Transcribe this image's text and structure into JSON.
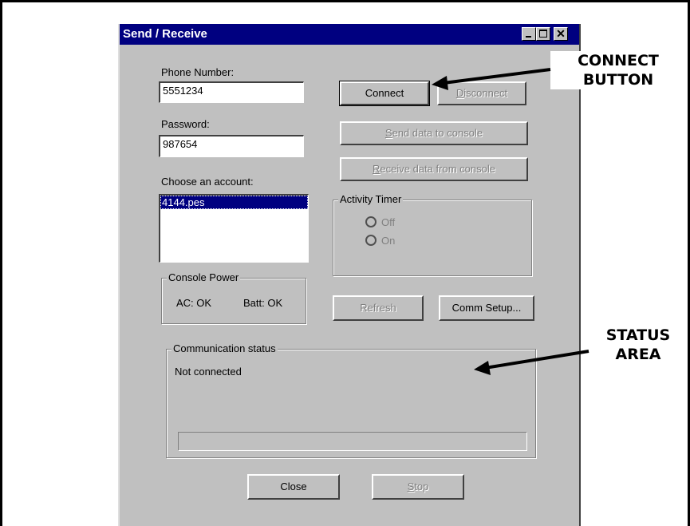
{
  "window": {
    "title": "Send / Receive",
    "controls": {
      "minimize": "_",
      "maximize": "□",
      "close": "✕"
    }
  },
  "phone": {
    "label": "Phone Number:",
    "value": "5551234"
  },
  "password": {
    "label": "Password:",
    "value": "987654"
  },
  "account": {
    "label": "Choose an account:",
    "items": [
      "4144.pes"
    ],
    "selected": "4144.pes"
  },
  "console_power": {
    "title": "Console Power",
    "ac": "AC: OK",
    "batt": "Batt: OK"
  },
  "buttons": {
    "connect": "Connect",
    "disconnect": "Disconnect",
    "send": "Send data to console",
    "receive": "Receive data from console",
    "refresh": "Refresh",
    "comm_setup": "Comm Setup...",
    "close": "Close",
    "stop": "Stop"
  },
  "activity_timer": {
    "title": "Activity Timer",
    "off": "Off",
    "on": "On"
  },
  "comm_status": {
    "title": "Communication status",
    "text": "Not connected",
    "progress": 0
  },
  "annotations": {
    "connect_button_line1": "CONNECT",
    "connect_button_line2": "BUTTON",
    "status_area_line1": "STATUS",
    "status_area_line2": "AREA"
  }
}
